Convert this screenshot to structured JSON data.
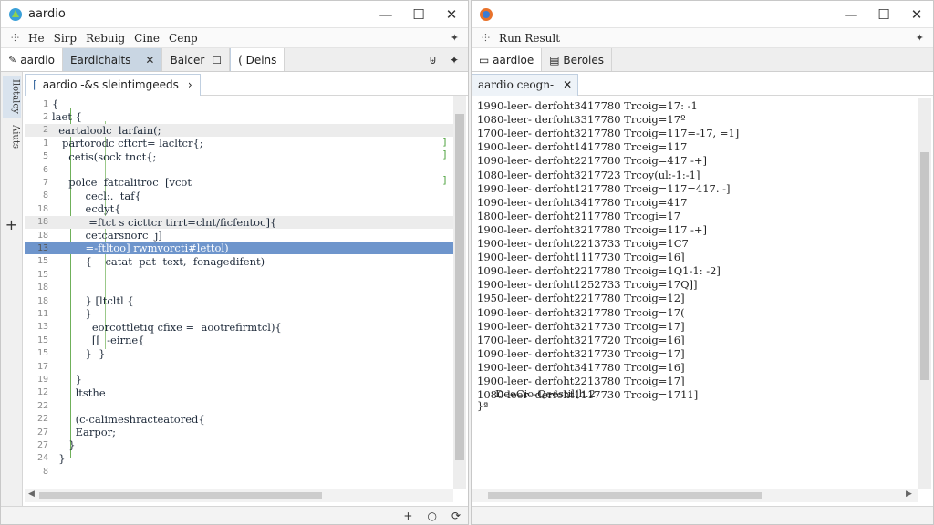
{
  "left_window": {
    "title": "aardio",
    "controls": [
      "—",
      "☐",
      "✕"
    ],
    "menu": [
      "He",
      "Sirp",
      "Rebuig",
      "Cine",
      "Cenp"
    ],
    "menu_pin": "✦",
    "tabs": [
      {
        "label": "aardio"
      },
      {
        "label": "Eardichalts",
        "close": "✕"
      },
      {
        "label": "Baicer"
      },
      {
        "label": "☐"
      },
      {
        "label": "( Deins"
      }
    ],
    "tab_icons": [
      "⊎",
      "✦"
    ],
    "sidebar": {
      "items": [
        "Ilotaley",
        "Aiuts"
      ],
      "add": "+"
    },
    "file_tab": {
      "label": "aardio -&s sleintimgeeds",
      "chevron": "›"
    },
    "code_lines": [
      {
        "n": "1",
        "t": "{"
      },
      {
        "n": "2",
        "t": "laet {"
      },
      {
        "n": "2",
        "t": "  eartaloolc  larfain(;"
      },
      {
        "n": "1",
        "t": "   partorodc cftcrt= lacltcr{;"
      },
      {
        "n": "5",
        "t": "     cetis(sock tnct{;"
      },
      {
        "n": "6",
        "t": ""
      },
      {
        "n": "7",
        "t": "     polce  fatcalitroc  [vcot"
      },
      {
        "n": "8",
        "t": "          cecl:.  taf{"
      },
      {
        "n": "18",
        "t": "          ecdyt{"
      },
      {
        "n": "18",
        "t": "           =ftct s cicttcr tirrt=clnt/ficfentoc]{"
      },
      {
        "n": "18",
        "t": "          cetcarsnorc  j]"
      },
      {
        "n": "13",
        "t": "          =-ftltoo] rwmvorcti#lettol)"
      },
      {
        "n": "15",
        "t": "          {    catat  pat  text,  fonagedifent)"
      },
      {
        "n": "15",
        "t": ""
      },
      {
        "n": "18",
        "t": ""
      },
      {
        "n": "18",
        "t": "          } [ltcltl {"
      },
      {
        "n": "11",
        "t": "          }"
      },
      {
        "n": "13",
        "t": "            eorcottletiq cfixe =  aootrefirmtcl){"
      },
      {
        "n": "15",
        "t": "            [[  -eirne{"
      },
      {
        "n": "15",
        "t": "          }  }"
      },
      {
        "n": "17",
        "t": ""
      },
      {
        "n": "19",
        "t": "       }"
      },
      {
        "n": "12",
        "t": "       ltsthe"
      },
      {
        "n": "22",
        "t": ""
      },
      {
        "n": "22",
        "t": "       (c-calimeshracteatored{"
      },
      {
        "n": "27",
        "t": "       Earpor;"
      },
      {
        "n": "27",
        "t": "     }"
      },
      {
        "n": "24",
        "t": "  }"
      },
      {
        "n": "8",
        "t": ""
      },
      {
        "n": "",
        "t": ""
      }
    ],
    "end_marks": [
      "]",
      "]",
      "]"
    ],
    "status_icons": [
      "+",
      "○",
      "⟳"
    ]
  },
  "right_window": {
    "title": "",
    "controls": [
      "—",
      "☐",
      "✕"
    ],
    "menu": [
      "Run Result"
    ],
    "menu_pin": "✦",
    "tabs": [
      {
        "label": "▭ aardioe"
      },
      {
        "label": "▤ Beroies"
      }
    ],
    "output_tab": {
      "label": "aardio ceogn-",
      "close": "✕"
    },
    "output_lines": [
      "1990-leer- derfoht3417780 Trcoig=17: -1",
      "1080-leer- derfoht3317780 Trcoig=17º",
      "1700-leer- derfoht3217780 Trcoig=117=-17, =1]",
      "1900-leer- derfoht1417780 Trceig=117",
      "1090-leer- derfoht2217780 Trcoig=417 -+]",
      "1080-leer- derfoht3217723 Trcoy(ul:-1:-1]",
      "1990-leer- derfoht1217780 Trceig=117=417. -]",
      "1090-leer- derfoht3417780 Trcoig=417",
      "1800-leer- derfoht2117780 Trcogi=17",
      "1900-leer- derfoht3217780 Trcoig=117 -+]",
      "1900-leer- derfoht2213733 Trcoig=1C7",
      "1900-leer- derfoht1117730 Trcoig=16]",
      "1090-leer- derfoht2217780 Trcoig=1Q1-1: -2]",
      "1900-leer- derfoht1252733 Trcoig=17Q]]",
      "1950-leer- derfoht2217780 Trcoig=12]",
      "1090-leer- derfoht3217780 Trcoig=17(",
      "1900-leer- derfoht3217730 Trcoig=17]",
      "1700-leer- derfoht3217720 Trcoig=16]",
      "1090-leer- derfoht3217730 Trcoig=17]",
      "1900-leer- derfoht3417780 Trcoig=16]",
      "1900-leer- derfoht2213780 Trcoig=17]",
      "1080-leer- derfoht1117730 Trcoig=1711]"
    ],
    "summary": "DeeCio-Qeestil(h.2",
    "summary_tag": "}ª"
  }
}
